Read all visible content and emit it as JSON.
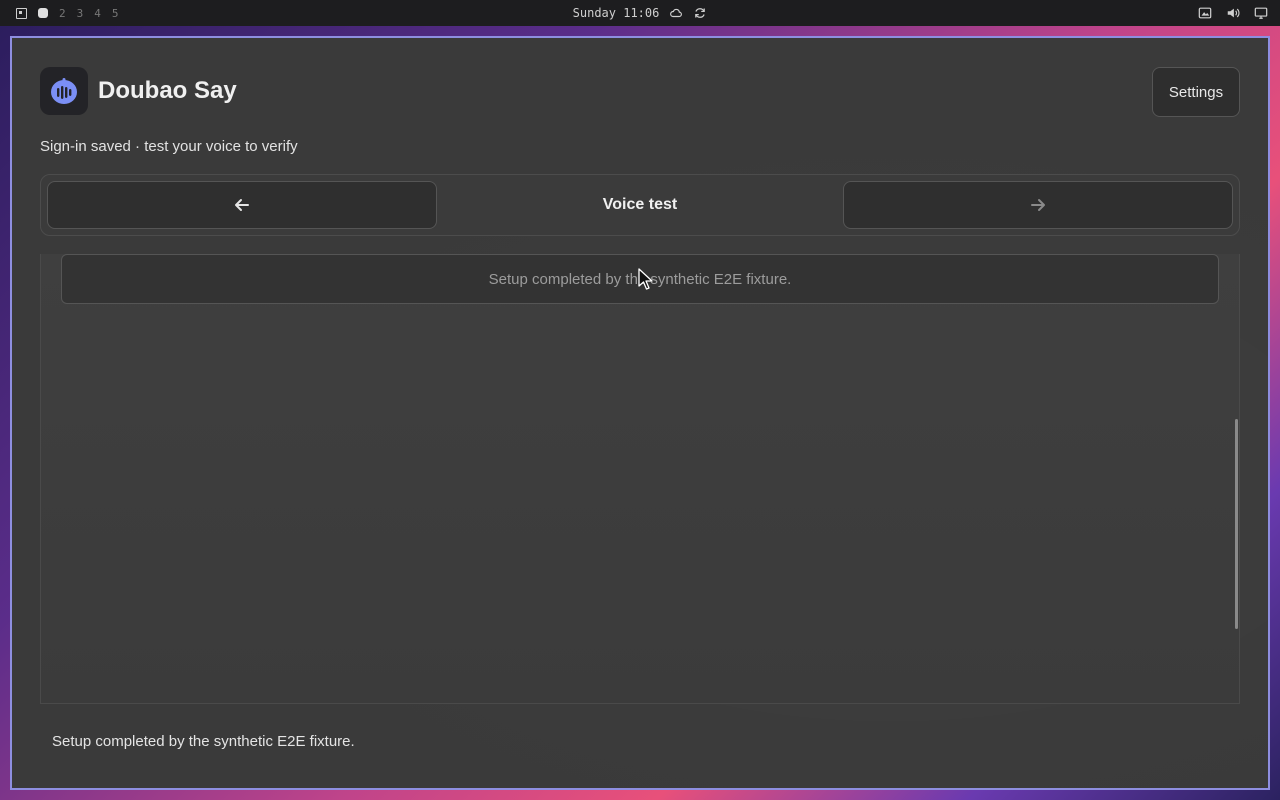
{
  "topbar": {
    "workspaces": [
      "2",
      "3",
      "4",
      "5"
    ],
    "clock": "Sunday 11:06",
    "icons": [
      "cloud-icon",
      "refresh-icon",
      "screenshot-icon",
      "volume-icon",
      "display-icon"
    ]
  },
  "app": {
    "title": "Doubao Say",
    "subtitle": "Sign-in saved · test your voice to verify",
    "settings_label": "Settings",
    "accent": "#7b8ff5"
  },
  "nav": {
    "title": "Voice test",
    "prev_icon": "arrow-left-icon",
    "next_icon": "arrow-right-icon"
  },
  "content": {
    "status_message": "Setup completed by the synthetic E2E fixture."
  },
  "footer": {
    "status_message": "Setup completed by the synthetic E2E fixture."
  }
}
